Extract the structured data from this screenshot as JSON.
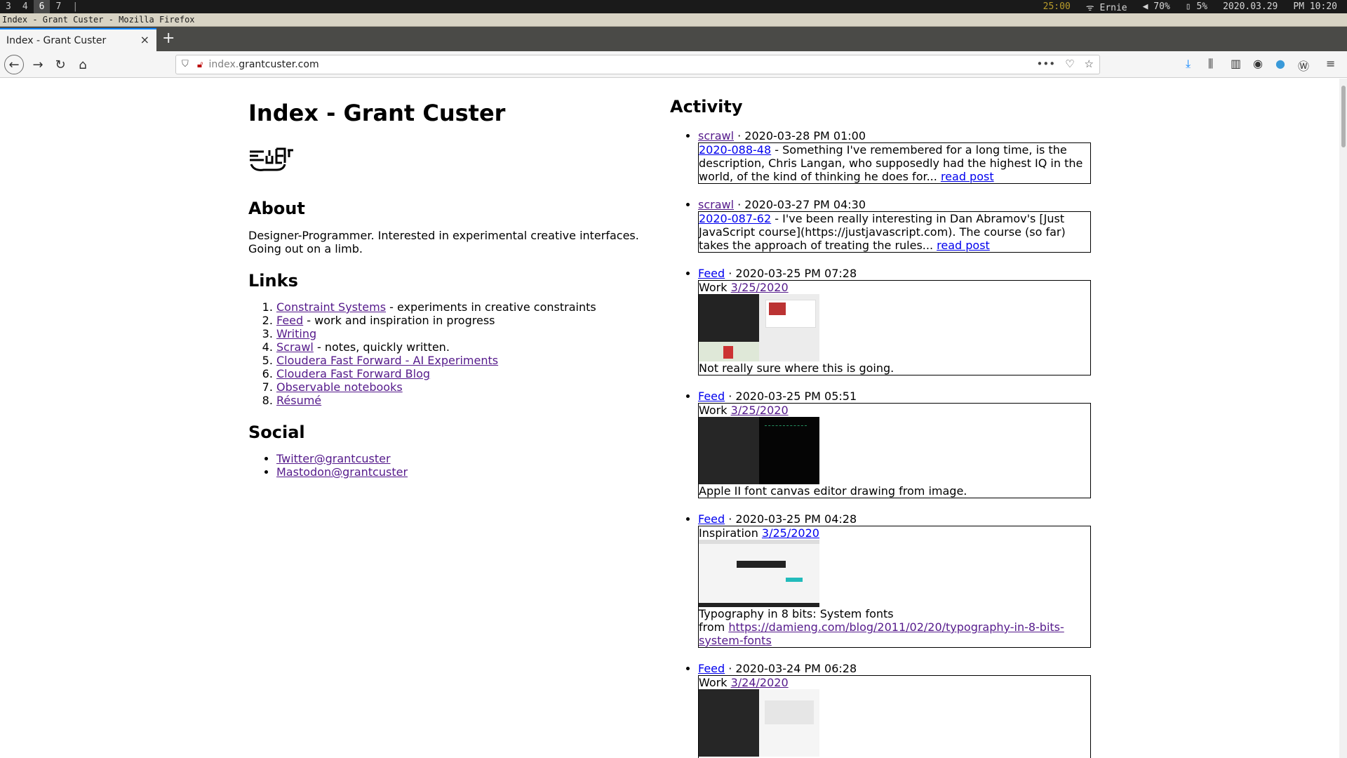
{
  "i3": {
    "workspaces": [
      "3",
      "4",
      "6",
      "7"
    ],
    "active_workspace": "6",
    "separator": "|",
    "timer": "25:00",
    "wifi": "Ernie",
    "volume": "70%",
    "battery": "5%",
    "date": "2020.03.29",
    "time": "PM 10:20"
  },
  "window_title": "Index - Grant Custer - Mozilla Firefox",
  "tab": {
    "title": "Index - Grant Custer",
    "close": "×"
  },
  "newtab": "+",
  "url": {
    "prefix": "index.",
    "domain": "grantcuster.com"
  },
  "page": {
    "title": "Index - Grant Custer",
    "about_heading": "About",
    "about_text": "Designer-Programmer. Interested in experimental creative interfaces. Going out on a limb.",
    "links_heading": "Links",
    "links": [
      {
        "label": "Constraint Systems",
        "desc": " - experiments in creative constraints"
      },
      {
        "label": "Feed",
        "desc": " - work and inspiration in progress"
      },
      {
        "label": "Writing",
        "desc": ""
      },
      {
        "label": "Scrawl",
        "desc": " - notes, quickly written."
      },
      {
        "label": "Cloudera Fast Forward - AI Experiments",
        "desc": ""
      },
      {
        "label": "Cloudera Fast Forward Blog",
        "desc": ""
      },
      {
        "label": "Observable notebooks",
        "desc": ""
      },
      {
        "label": "Résumé",
        "desc": ""
      }
    ],
    "social_heading": "Social",
    "social": [
      "Twitter@grantcuster",
      "Mastodon@grantcuster"
    ]
  },
  "activity": {
    "heading": "Activity",
    "items": [
      {
        "source": "scrawl",
        "datetime": " · 2020-03-28 PM 01:00",
        "id": "2020-088-48",
        "text": " - Something I've remembered for a long time, is the description, Chris Langan, who supposedly had the highest IQ in the world, of the kind of thinking he does for... ",
        "read": "read post"
      },
      {
        "source": "scrawl",
        "datetime": " · 2020-03-27 PM 04:30",
        "id": "2020-087-62",
        "text": " - I've been really interesting in Dan Abramov's [Just JavaScript course](https://justjavascript.com). The course (so far) takes the approach of treating the rules... ",
        "read": "read post"
      },
      {
        "source": "Feed",
        "datetime": " · 2020-03-25 PM 07:28",
        "kind": "Work",
        "date": "3/25/2020",
        "caption": "Not really sure where this is going."
      },
      {
        "source": "Feed",
        "datetime": " · 2020-03-25 PM 05:51",
        "kind": "Work",
        "date": "3/25/2020",
        "caption": "Apple II font canvas editor drawing from image."
      },
      {
        "source": "Feed",
        "datetime": " · 2020-03-25 PM 04:28",
        "kind": "Inspiration",
        "date": "3/25/2020",
        "caption": "Typography in 8 bits: System fonts",
        "from": "from ",
        "link": "https://damieng.com/blog/2011/02/20/typography-in-8-bits-system-fonts"
      },
      {
        "source": "Feed",
        "datetime": " · 2020-03-24 PM 06:28",
        "kind": "Work",
        "date": "3/24/2020"
      }
    ]
  }
}
